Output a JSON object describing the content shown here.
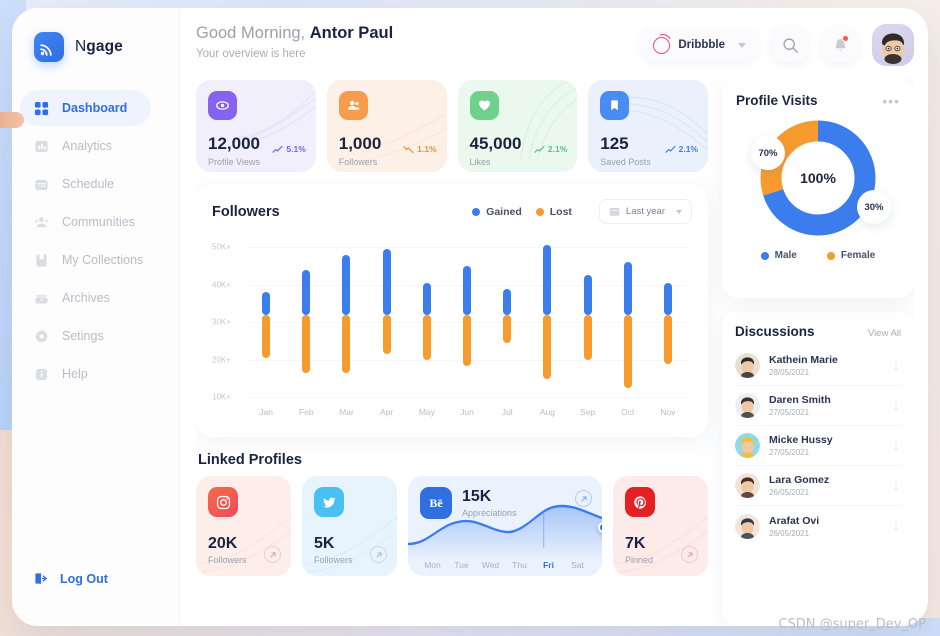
{
  "brand": {
    "name_light": "N",
    "name_bold": "gage"
  },
  "sidebar": {
    "items": [
      {
        "label": "Dashboard",
        "icon": "grid-icon"
      },
      {
        "label": "Analytics",
        "icon": "bar-chart-icon"
      },
      {
        "label": "Schedule",
        "icon": "calendar-icon"
      },
      {
        "label": "Communities",
        "icon": "people-icon"
      },
      {
        "label": "My Collections",
        "icon": "bookmark-icon"
      },
      {
        "label": "Archives",
        "icon": "archive-icon"
      },
      {
        "label": "Setings",
        "icon": "gear-icon"
      },
      {
        "label": "Help",
        "icon": "info-icon"
      }
    ],
    "logout": "Log Out"
  },
  "header": {
    "greeting_prefix": "Good Morning, ",
    "user_name": "Antor Paul",
    "subtitle": "Your overview is here",
    "source_select": "Dribbble"
  },
  "stats": [
    {
      "value": "12,000",
      "label": "Profile Views",
      "pct": "5.1%",
      "dir": "up",
      "bg": "#f1effc",
      "sq": "#8562f0",
      "accent": "#7c5cf0",
      "icon": "eye-icon"
    },
    {
      "value": "1,000",
      "label": "Followers",
      "pct": "1.1%",
      "dir": "down",
      "bg": "#fdf0e6",
      "sq": "#f79b4c",
      "accent": "#f08c3a",
      "icon": "users-icon"
    },
    {
      "value": "45,000",
      "label": "Likes",
      "pct": "2.1%",
      "dir": "up",
      "bg": "#eaf8ee",
      "sq": "#6fd18c",
      "accent": "#5fc07c",
      "icon": "heart-icon"
    },
    {
      "value": "125",
      "label": "Saved Posts",
      "pct": "2.1%",
      "dir": "up",
      "bg": "#eaf1fc",
      "sq": "#4a8cf5",
      "accent": "#3b7ded",
      "icon": "bookmark-icon"
    }
  ],
  "followers_chart": {
    "title": "Followers",
    "legend": [
      {
        "label": "Gained",
        "color": "#3b7ded"
      },
      {
        "label": "Lost",
        "color": "#f79b2f"
      }
    ],
    "range_label": "Last year"
  },
  "chart_data": {
    "type": "bar",
    "title": "Followers",
    "xlabel": "",
    "ylabel": "",
    "categories": [
      "Jan",
      "Feb",
      "Mar",
      "Apr",
      "May",
      "Jun",
      "Jul",
      "Aug",
      "Sep",
      "Oct",
      "Nov"
    ],
    "ytick_labels": [
      "50K+",
      "40K+",
      "30K+",
      "20K+",
      "10K+"
    ],
    "yticks": [
      50000,
      40000,
      30000,
      20000,
      10000
    ],
    "ylim": [
      8000,
      53000
    ],
    "grid": true,
    "legend_position": "top-right",
    "note": "Floating bars: blue 'Gained' segment spans from 32K to top value; orange 'Lost' segment spans from bottom value up to 32K.",
    "split_value": 32000,
    "series": [
      {
        "name": "Gained",
        "color": "#3b7ded",
        "values": [
          38000,
          44000,
          48000,
          49500,
          40500,
          45000,
          39000,
          50500,
          42500,
          46000,
          40500
        ]
      },
      {
        "name": "Lost",
        "color": "#f79b2f",
        "values": [
          20500,
          16500,
          16500,
          21500,
          20000,
          18500,
          24500,
          15000,
          20000,
          12500,
          19000
        ]
      }
    ]
  },
  "linked_profiles": {
    "title": "Linked Profiles",
    "cards": [
      {
        "network": "instagram-icon",
        "value": "20K",
        "label": "Followers",
        "bg": "#fdeeea",
        "sq": "#f26a4b"
      },
      {
        "network": "twitter-icon",
        "value": "5K",
        "label": "Followers",
        "bg": "#e7f4fd",
        "sq": "#4ac0f2"
      },
      {
        "network": "pinterest-icon",
        "value": "7K",
        "label": "Pinned",
        "bg": "#fdebe9",
        "sq": "#e32124"
      }
    ],
    "behance": {
      "network": "behance-icon",
      "value": "15K",
      "label": "Appreciations",
      "bg": "#eaf2fd",
      "sq": "#2f6fe0",
      "days": [
        "Mon",
        "Tue",
        "Wed",
        "Thu",
        "Fri",
        "Sat"
      ],
      "active_day": "Fri",
      "spark_values": [
        18,
        22,
        48,
        52,
        44,
        46,
        68,
        74,
        62
      ]
    }
  },
  "profile_visits": {
    "title": "Profile Visits",
    "center_value": "100%",
    "bubble_left": "70%",
    "bubble_right": "30%",
    "legend": [
      {
        "label": "Male",
        "color": "#3b7ded",
        "value": 70
      },
      {
        "label": "Female",
        "color": "#f79b2f",
        "value": 30
      }
    ]
  },
  "discussions": {
    "title": "Discussions",
    "view_all": "View All",
    "items": [
      {
        "name": "Kathein Marie",
        "date": "28/05/2021",
        "av1": "#e9ded4",
        "av2": "#2e2a2b"
      },
      {
        "name": "Daren Smith",
        "date": "27/05/2021",
        "av1": "#eceff2",
        "av2": "#3b3330"
      },
      {
        "name": "Micke Hussy",
        "date": "27/05/2021",
        "av1": "#8fd9ea",
        "av2": "#f2c12e"
      },
      {
        "name": "Lara Gomez",
        "date": "26/05/2021",
        "av1": "#f0e3d8",
        "av2": "#4a2d22"
      },
      {
        "name": "Arafat Ovi",
        "date": "26/05/2021",
        "av1": "#f2e6dc",
        "av2": "#2f3a4a"
      }
    ]
  },
  "watermark": "CSDN @super_Dev_OP"
}
